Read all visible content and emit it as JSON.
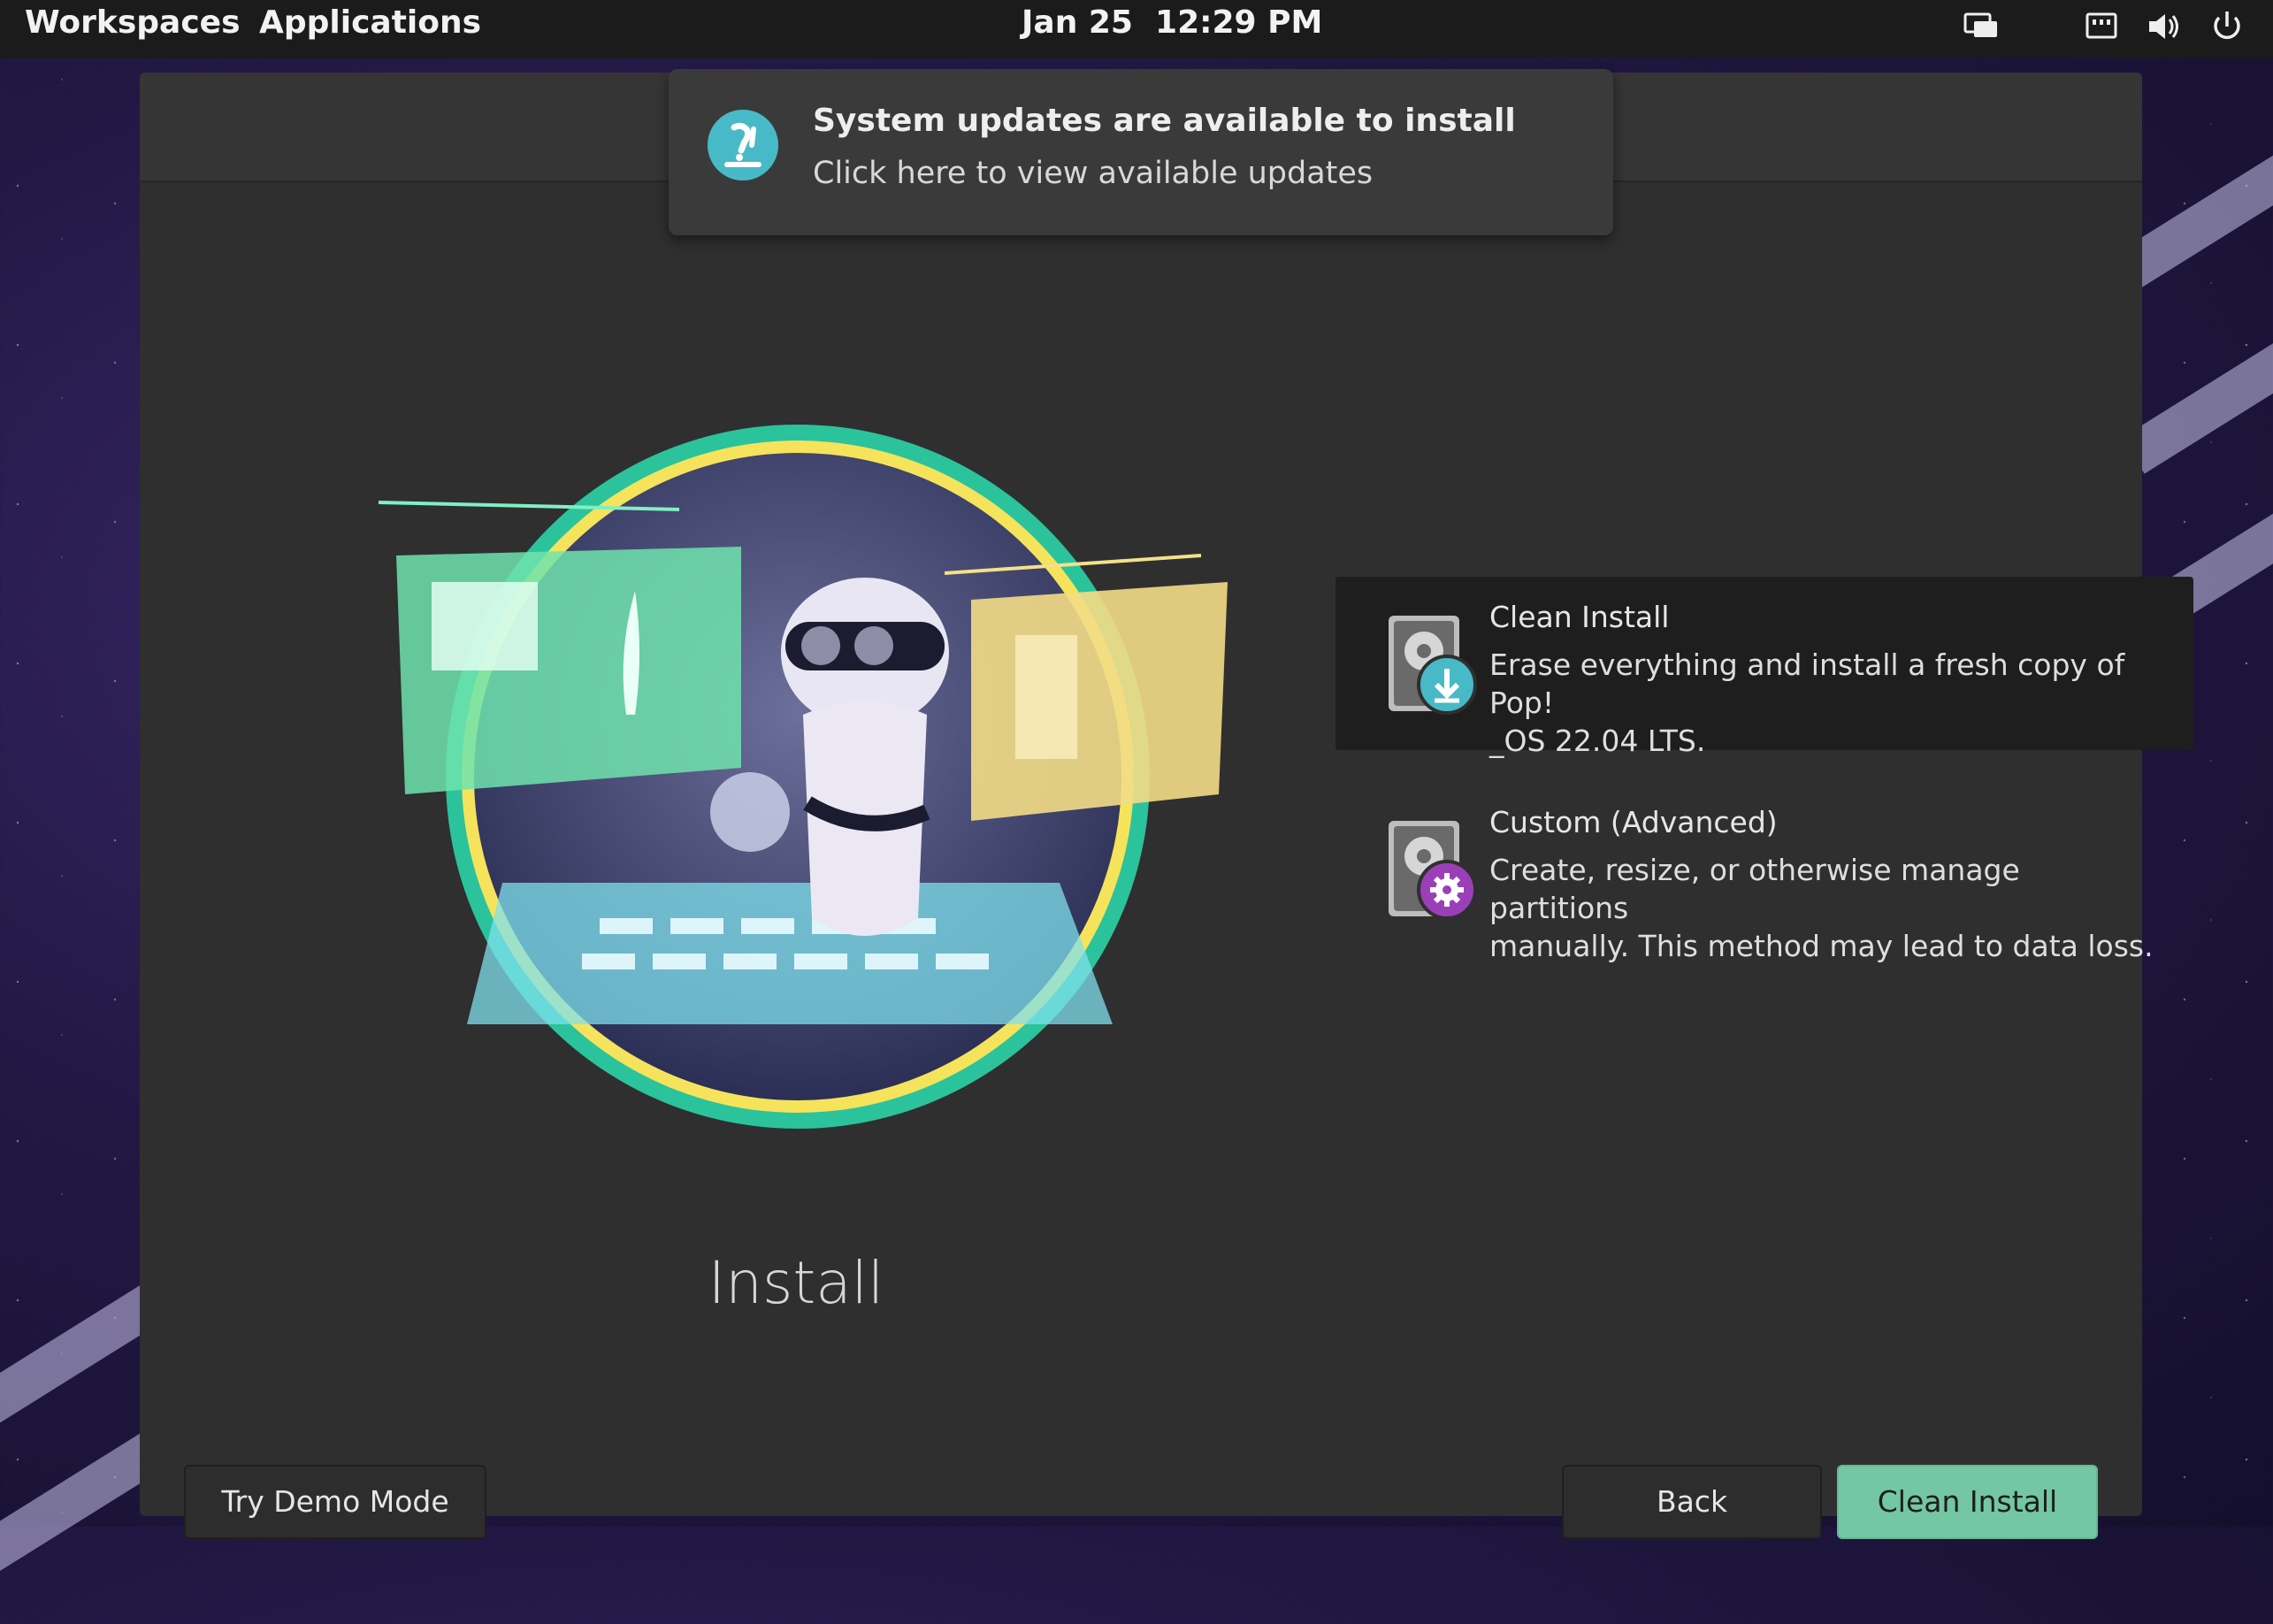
{
  "topbar": {
    "workspaces": "Workspaces",
    "applications": "Applications",
    "clock": "Jan 25  12:29 PM",
    "icons": [
      "display-settings-icon",
      "network-icon",
      "volume-icon",
      "power-icon"
    ]
  },
  "notification": {
    "title": "System updates are available to install",
    "body": "Click here to view available updates",
    "icon": "pop-shop-icon"
  },
  "page": {
    "title": "Install"
  },
  "options": [
    {
      "title": "Clean Install",
      "desc_line1": "Erase everything and install a fresh copy of Pop!",
      "desc_line2": "_OS 22.04 LTS.",
      "icon": "disk-download-icon",
      "selected": true
    },
    {
      "title": "Custom (Advanced)",
      "desc_line1": "Create, resize, or otherwise manage partitions",
      "desc_line2": "manually. This method may lead to data loss.",
      "icon": "disk-gear-icon",
      "selected": false
    }
  ],
  "buttons": {
    "demo": "Try Demo Mode",
    "back": "Back",
    "primary": "Clean Install"
  },
  "colors": {
    "accent": "#73c7a3",
    "notif_icon": "#48b9c7",
    "custom_icon": "#9b3fb8"
  }
}
